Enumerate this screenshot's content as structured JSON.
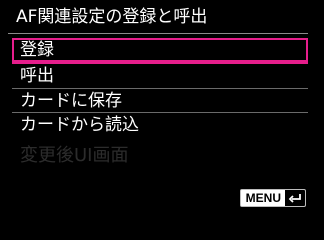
{
  "screen": {
    "title": "AF関連設定の登録と呼出",
    "menu_items": [
      {
        "label": "登録",
        "selected": true
      },
      {
        "label": "呼出",
        "selected": false
      },
      {
        "label": "カードに保存",
        "selected": false
      },
      {
        "label": "カードから読込",
        "selected": false
      },
      {
        "label": "変更後UI画面",
        "selected": false,
        "dimmed": true
      }
    ],
    "menu_button": {
      "label": "MENU",
      "icon": "back-arrow-icon"
    }
  },
  "colors": {
    "background": "#000000",
    "text": "#ffffff",
    "selection": "#e61e8c",
    "dimmed_text": "#2c2c2c"
  }
}
